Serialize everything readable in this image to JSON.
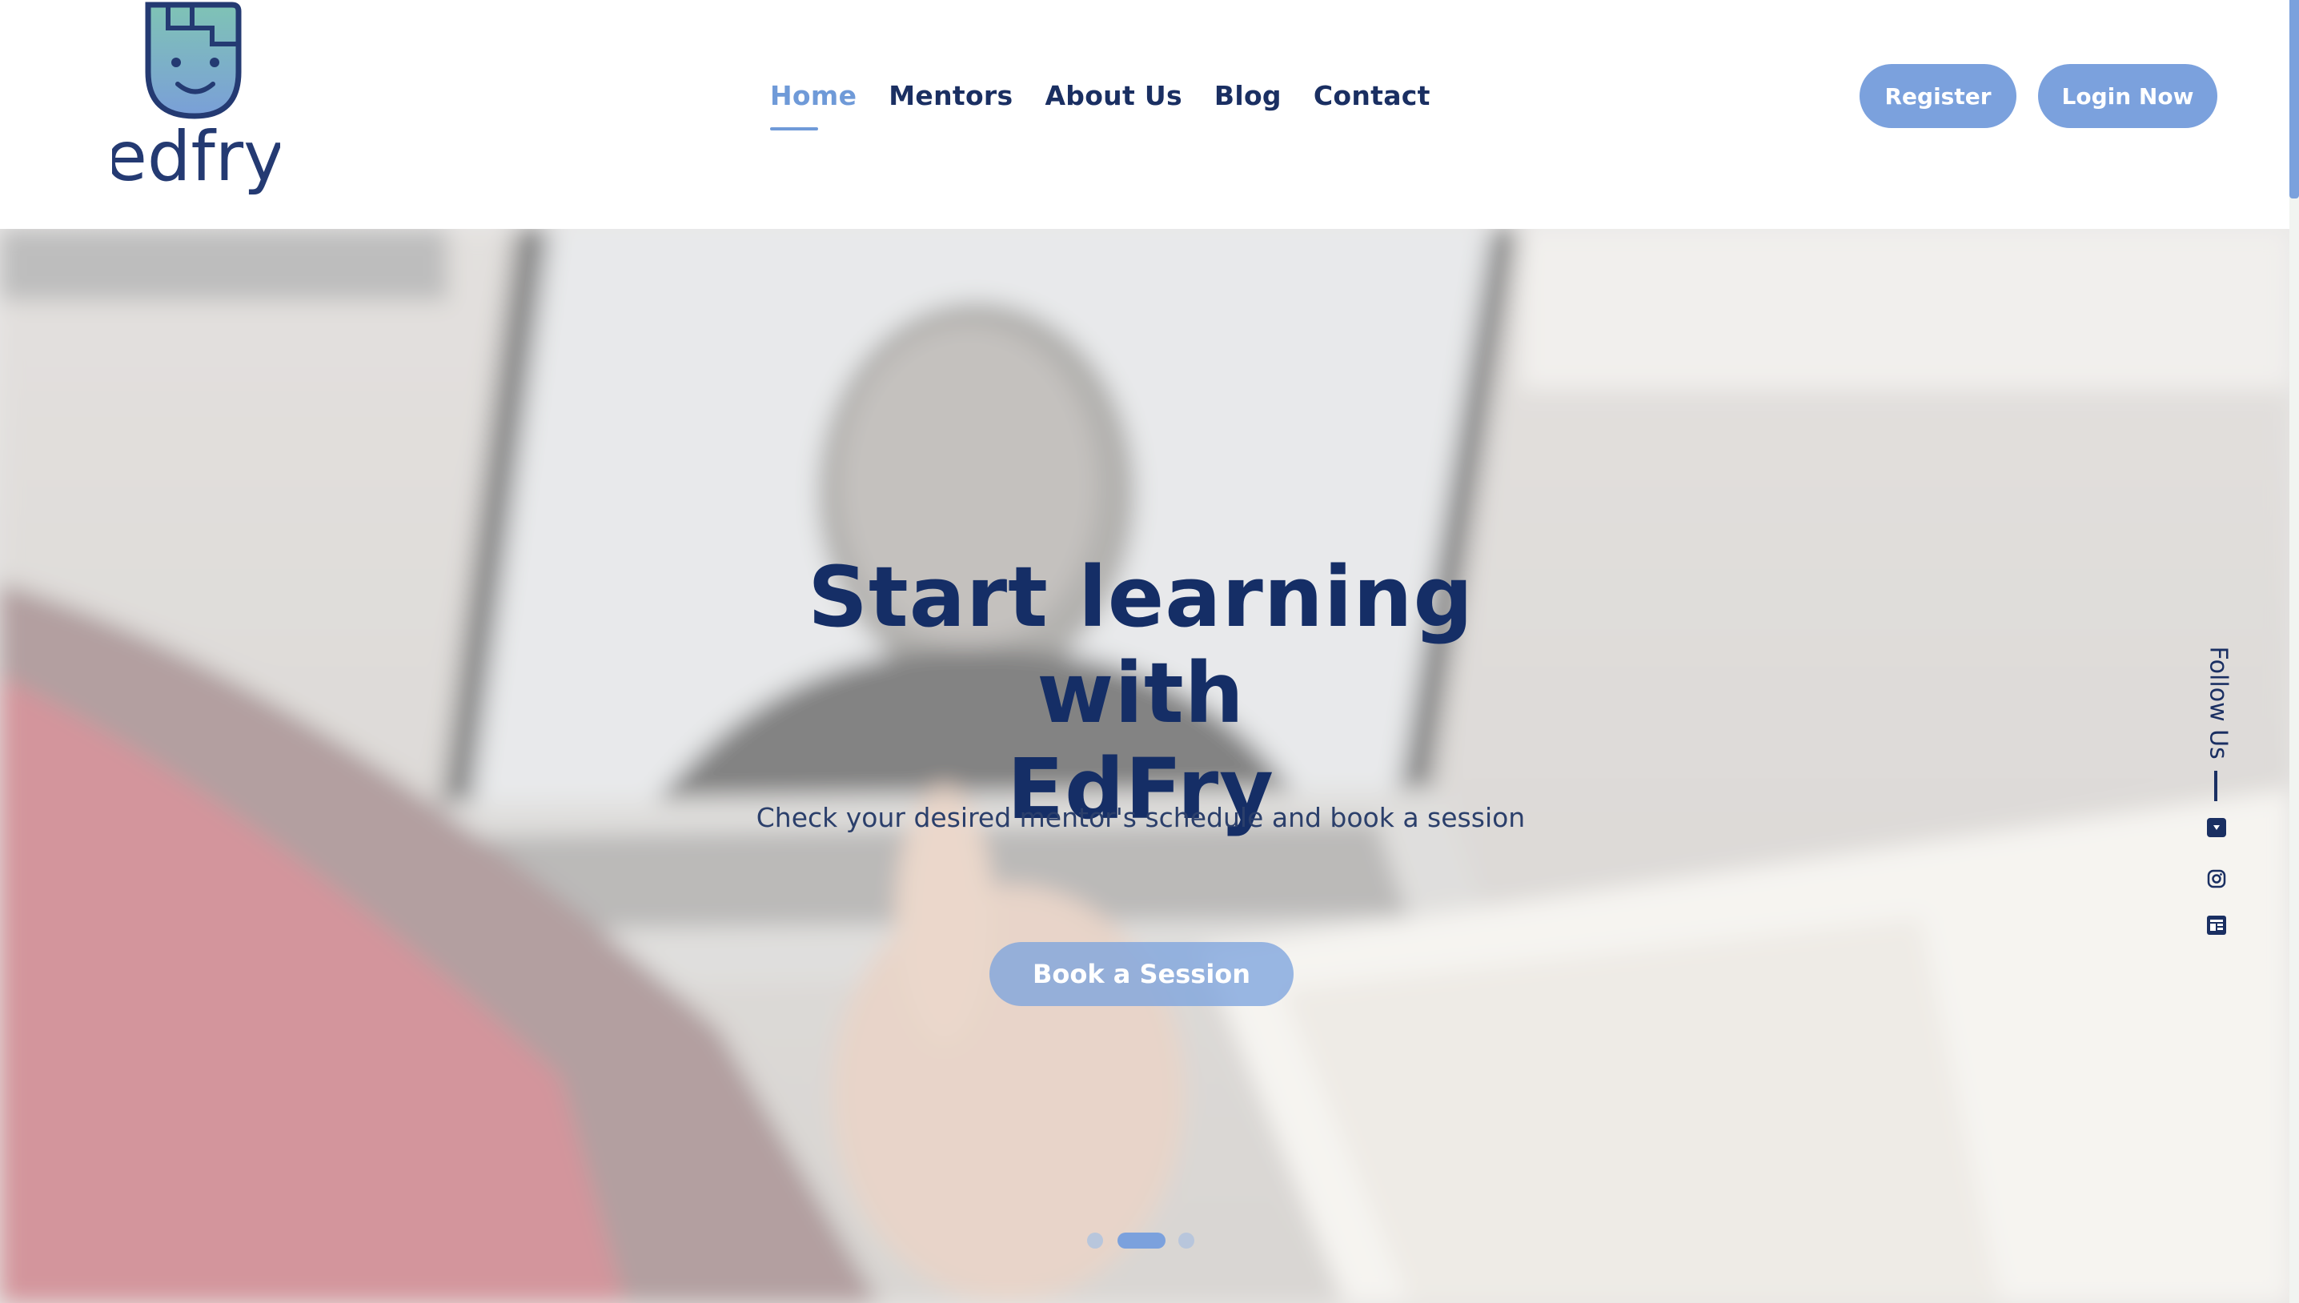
{
  "brand": {
    "name": "edfry",
    "accent": "#7ba1dd",
    "navy": "#1a2f62"
  },
  "nav": {
    "items": [
      {
        "label": "Home",
        "active": true
      },
      {
        "label": "Mentors",
        "active": false
      },
      {
        "label": "About Us",
        "active": false
      },
      {
        "label": "Blog",
        "active": false
      },
      {
        "label": "Contact",
        "active": false
      }
    ]
  },
  "header": {
    "register_label": "Register",
    "login_label": "Login Now"
  },
  "hero": {
    "title_line1": "Start learning with",
    "title_line2": "EdFry",
    "subtitle": "Check your desired mentor's schedule and book a session",
    "cta_label": "Book a Session",
    "slides": {
      "count": 3,
      "active_index": 2
    }
  },
  "follow": {
    "label": "Follow Us",
    "icons": [
      "youtube-icon",
      "instagram-icon",
      "blog-icon"
    ]
  }
}
